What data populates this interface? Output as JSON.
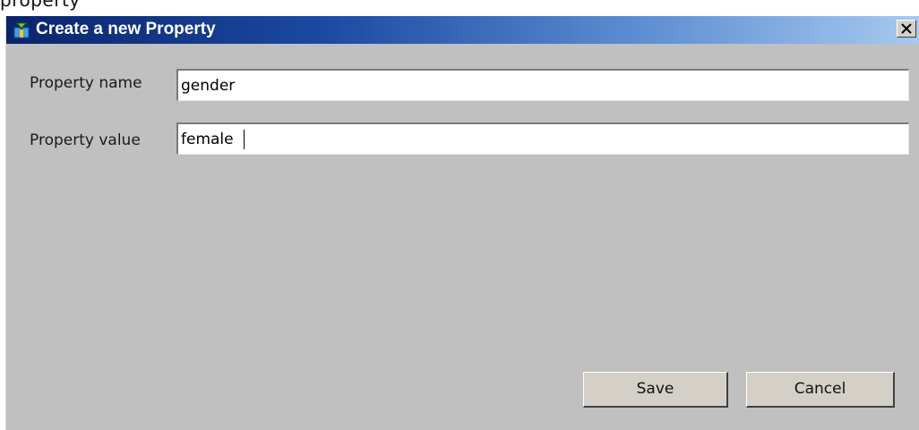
{
  "window": {
    "title": "Create a new Property",
    "close_glyph": "✕"
  },
  "form": {
    "name_label": "Property name",
    "name_value": "gender",
    "value_label": "Property value",
    "value_value": "female"
  },
  "buttons": {
    "save_label": "Save",
    "cancel_label": "Cancel"
  },
  "icons": {
    "app": "app-window-icon",
    "close": "close-icon"
  },
  "colors": {
    "dialog_bg": "#c0c0c0",
    "titlebar_start": "#0a246a",
    "titlebar_end": "#a6caf0",
    "button_face": "#d4d0c8"
  }
}
